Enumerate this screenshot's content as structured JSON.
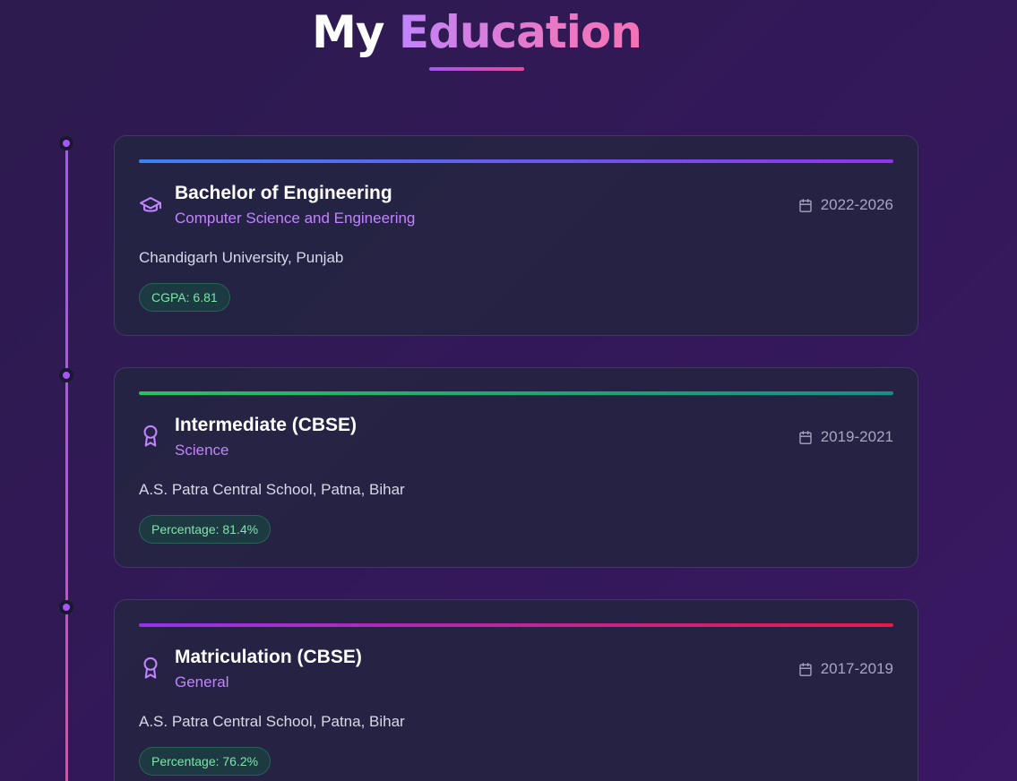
{
  "header": {
    "title_word1": "My",
    "title_word2": "Education"
  },
  "colors": {
    "accent_purple": "#a855f7",
    "accent_pink": "#ec4899",
    "field_text": "#c084fc",
    "badge_text": "#7ee6a8"
  },
  "education": [
    {
      "degree": "Bachelor of Engineering",
      "field": "Computer Science and Engineering",
      "years": "2022-2026",
      "institution": "Chandigarh University, Punjab",
      "score": "CGPA: 6.81",
      "icon": "graduation-cap-icon"
    },
    {
      "degree": "Intermediate (CBSE)",
      "field": "Science",
      "years": "2019-2021",
      "institution": "A.S. Patra Central School, Patna, Bihar",
      "score": "Percentage: 81.4%",
      "icon": "award-icon"
    },
    {
      "degree": "Matriculation (CBSE)",
      "field": "General",
      "years": "2017-2019",
      "institution": "A.S. Patra Central School, Patna, Bihar",
      "score": "Percentage: 76.2%",
      "icon": "award-icon"
    }
  ]
}
